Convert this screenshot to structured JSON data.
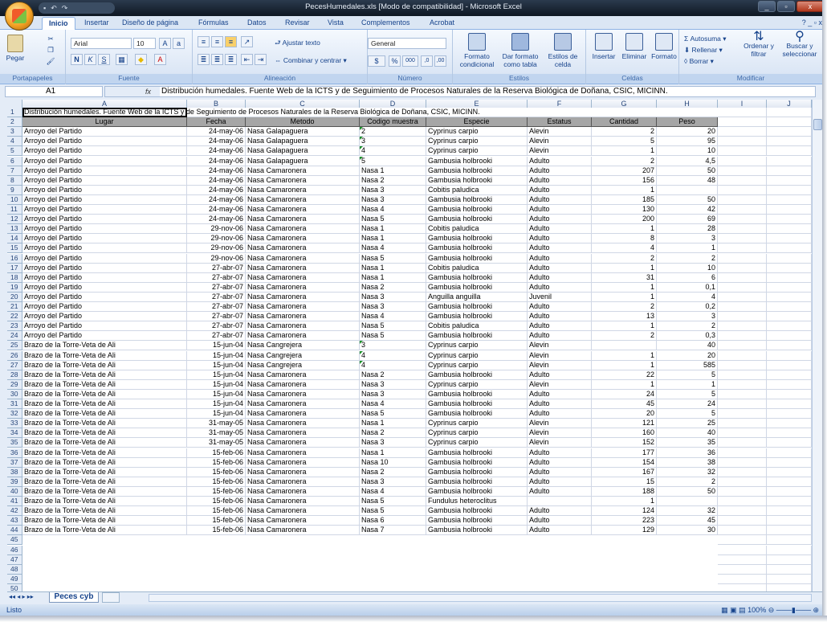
{
  "window": {
    "title": "PecesHumedales.xls  [Modo de compatibilidad] - Microsoft Excel",
    "controls": [
      "_",
      "▫",
      "x"
    ]
  },
  "tabs": [
    "Inicio",
    "Insertar",
    "Diseño de página",
    "Fórmulas",
    "Datos",
    "Revisar",
    "Vista",
    "Complementos",
    "Acrobat"
  ],
  "ribbon": {
    "paste": "Pegar",
    "clipboard_label": "Portapapeles",
    "font_name": "Arial",
    "font_size": "10",
    "font_label": "Fuente",
    "wrap_text": "Ajustar texto",
    "merge_center": "Combinar y centrar",
    "align_label": "Alineación",
    "number_format": "General",
    "number_label": "Número",
    "cond_format": "Formato condicional",
    "format_table": "Dar formato como tabla",
    "cell_styles": "Estilos de celda",
    "styles_label": "Estilos",
    "insert": "Insertar",
    "delete": "Eliminar",
    "format": "Formato",
    "cells_label": "Celdas",
    "autosum": "Autosuma",
    "fill": "Rellenar",
    "clear": "Borrar",
    "sort_filter": "Ordenar y filtrar",
    "find_select": "Buscar y seleccionar",
    "modify_label": "Modificar"
  },
  "formula_bar": {
    "name_box": "A1",
    "fx": "fx",
    "content": "Distribución humedales. Fuente Web de la ICTS y de Seguimiento de Procesos Naturales de la Reserva Biológica de Doñana, CSIC, MICINN."
  },
  "columns": [
    "A",
    "B",
    "C",
    "D",
    "E",
    "F",
    "G",
    "H",
    "I",
    "J"
  ],
  "title_cell": "Distribución humedales. Fuente Web de la ICTS y de Seguimiento de Procesos Naturales de la Reserva Biológica de Doñana, CSIC, MICINN.",
  "headers": [
    "Lugar",
    "Fecha",
    "Metodo",
    "Codigo muestra",
    "Especie",
    "Estatus",
    "Cantidad",
    "Peso"
  ],
  "rows": [
    [
      "Arroyo del Partido",
      "24-may-06",
      "Nasa Galapaguera",
      "2",
      "Cyprinus carpio",
      "Alevin",
      "2",
      "20"
    ],
    [
      "Arroyo del Partido",
      "24-may-06",
      "Nasa Galapaguera",
      "3",
      "Cyprinus carpio",
      "Alevin",
      "5",
      "95"
    ],
    [
      "Arroyo del Partido",
      "24-may-06",
      "Nasa Galapaguera",
      "4",
      "Cyprinus carpio",
      "Alevin",
      "1",
      "10"
    ],
    [
      "Arroyo del Partido",
      "24-may-06",
      "Nasa Galapaguera",
      "5",
      "Gambusia holbrooki",
      "Adulto",
      "2",
      "4,5"
    ],
    [
      "Arroyo del Partido",
      "24-may-06",
      "Nasa Camaronera",
      "Nasa 1",
      "Gambusia holbrooki",
      "Adulto",
      "207",
      "50"
    ],
    [
      "Arroyo del Partido",
      "24-may-06",
      "Nasa Camaronera",
      "Nasa 2",
      "Gambusia holbrooki",
      "Adulto",
      "156",
      "48"
    ],
    [
      "Arroyo del Partido",
      "24-may-06",
      "Nasa Camaronera",
      "Nasa 3",
      "Cobitis paludica",
      "Adulto",
      "1",
      ""
    ],
    [
      "Arroyo del Partido",
      "24-may-06",
      "Nasa Camaronera",
      "Nasa 3",
      "Gambusia holbrooki",
      "Adulto",
      "185",
      "50"
    ],
    [
      "Arroyo del Partido",
      "24-may-06",
      "Nasa Camaronera",
      "Nasa 4",
      "Gambusia holbrooki",
      "Adulto",
      "130",
      "42"
    ],
    [
      "Arroyo del Partido",
      "24-may-06",
      "Nasa Camaronera",
      "Nasa 5",
      "Gambusia holbrooki",
      "Adulto",
      "200",
      "69"
    ],
    [
      "Arroyo del Partido",
      "29-nov-06",
      "Nasa Camaronera",
      "Nasa 1",
      "Cobitis paludica",
      "Adulto",
      "1",
      "28"
    ],
    [
      "Arroyo del Partido",
      "29-nov-06",
      "Nasa Camaronera",
      "Nasa 1",
      "Gambusia holbrooki",
      "Adulto",
      "8",
      "3"
    ],
    [
      "Arroyo del Partido",
      "29-nov-06",
      "Nasa Camaronera",
      "Nasa 4",
      "Gambusia holbrooki",
      "Adulto",
      "4",
      "1"
    ],
    [
      "Arroyo del Partido",
      "29-nov-06",
      "Nasa Camaronera",
      "Nasa 5",
      "Gambusia holbrooki",
      "Adulto",
      "2",
      "2"
    ],
    [
      "Arroyo del Partido",
      "27-abr-07",
      "Nasa Camaronera",
      "Nasa 1",
      "Cobitis paludica",
      "Adulto",
      "1",
      "10"
    ],
    [
      "Arroyo del Partido",
      "27-abr-07",
      "Nasa Camaronera",
      "Nasa 1",
      "Gambusia holbrooki",
      "Adulto",
      "31",
      "6"
    ],
    [
      "Arroyo del Partido",
      "27-abr-07",
      "Nasa Camaronera",
      "Nasa 2",
      "Gambusia holbrooki",
      "Adulto",
      "1",
      "0,1"
    ],
    [
      "Arroyo del Partido",
      "27-abr-07",
      "Nasa Camaronera",
      "Nasa 3",
      "Anguilla anguilla",
      "Juvenil",
      "1",
      "4"
    ],
    [
      "Arroyo del Partido",
      "27-abr-07",
      "Nasa Camaronera",
      "Nasa 3",
      "Gambusia holbrooki",
      "Adulto",
      "2",
      "0,2"
    ],
    [
      "Arroyo del Partido",
      "27-abr-07",
      "Nasa Camaronera",
      "Nasa 4",
      "Gambusia holbrooki",
      "Adulto",
      "13",
      "3"
    ],
    [
      "Arroyo del Partido",
      "27-abr-07",
      "Nasa Camaronera",
      "Nasa 5",
      "Cobitis paludica",
      "Adulto",
      "1",
      "2"
    ],
    [
      "Arroyo del Partido",
      "27-abr-07",
      "Nasa Camaronera",
      "Nasa 5",
      "Gambusia holbrooki",
      "Adulto",
      "2",
      "0,3"
    ],
    [
      "Brazo de la Torre-Veta de Ali",
      "15-jun-04",
      "Nasa Cangrejera",
      "3",
      "Cyprinus carpio",
      "Alevin",
      "",
      "40"
    ],
    [
      "Brazo de la Torre-Veta de Ali",
      "15-jun-04",
      "Nasa Cangrejera",
      "4",
      "Cyprinus carpio",
      "Alevin",
      "1",
      "20"
    ],
    [
      "Brazo de la Torre-Veta de Ali",
      "15-jun-04",
      "Nasa Cangrejera",
      "4",
      "Cyprinus carpio",
      "Alevin",
      "1",
      "585"
    ],
    [
      "Brazo de la Torre-Veta de Ali",
      "15-jun-04",
      "Nasa Camaronera",
      "Nasa 2",
      "Gambusia holbrooki",
      "Adulto",
      "22",
      "5"
    ],
    [
      "Brazo de la Torre-Veta de Ali",
      "15-jun-04",
      "Nasa Camaronera",
      "Nasa 3",
      "Cyprinus carpio",
      "Alevin",
      "1",
      "1"
    ],
    [
      "Brazo de la Torre-Veta de Ali",
      "15-jun-04",
      "Nasa Camaronera",
      "Nasa 3",
      "Gambusia holbrooki",
      "Adulto",
      "24",
      "5"
    ],
    [
      "Brazo de la Torre-Veta de Ali",
      "15-jun-04",
      "Nasa Camaronera",
      "Nasa 4",
      "Gambusia holbrooki",
      "Adulto",
      "45",
      "24"
    ],
    [
      "Brazo de la Torre-Veta de Ali",
      "15-jun-04",
      "Nasa Camaronera",
      "Nasa 5",
      "Gambusia holbrooki",
      "Adulto",
      "20",
      "5"
    ],
    [
      "Brazo de la Torre-Veta de Ali",
      "31-may-05",
      "Nasa Camaronera",
      "Nasa 1",
      "Cyprinus carpio",
      "Alevin",
      "121",
      "25"
    ],
    [
      "Brazo de la Torre-Veta de Ali",
      "31-may-05",
      "Nasa Camaronera",
      "Nasa 2",
      "Cyprinus carpio",
      "Alevin",
      "160",
      "40"
    ],
    [
      "Brazo de la Torre-Veta de Ali",
      "31-may-05",
      "Nasa Camaronera",
      "Nasa 3",
      "Cyprinus carpio",
      "Alevin",
      "152",
      "35"
    ],
    [
      "Brazo de la Torre-Veta de Ali",
      "15-feb-06",
      "Nasa Camaronera",
      "Nasa 1",
      "Gambusia holbrooki",
      "Adulto",
      "177",
      "36"
    ],
    [
      "Brazo de la Torre-Veta de Ali",
      "15-feb-06",
      "Nasa Camaronera",
      "Nasa 10",
      "Gambusia holbrooki",
      "Adulto",
      "154",
      "38"
    ],
    [
      "Brazo de la Torre-Veta de Ali",
      "15-feb-06",
      "Nasa Camaronera",
      "Nasa 2",
      "Gambusia holbrooki",
      "Adulto",
      "167",
      "32"
    ],
    [
      "Brazo de la Torre-Veta de Ali",
      "15-feb-06",
      "Nasa Camaronera",
      "Nasa 3",
      "Gambusia holbrooki",
      "Adulto",
      "15",
      "2"
    ],
    [
      "Brazo de la Torre-Veta de Ali",
      "15-feb-06",
      "Nasa Camaronera",
      "Nasa 4",
      "Gambusia holbrooki",
      "Adulto",
      "188",
      "50"
    ],
    [
      "Brazo de la Torre-Veta de Ali",
      "15-feb-06",
      "Nasa Camaronera",
      "Nasa 5",
      "Fundulus heteroclitus",
      "",
      "1",
      ""
    ],
    [
      "Brazo de la Torre-Veta de Ali",
      "15-feb-06",
      "Nasa Camaronera",
      "Nasa 5",
      "Gambusia holbrooki",
      "Adulto",
      "124",
      "32"
    ],
    [
      "Brazo de la Torre-Veta de Ali",
      "15-feb-06",
      "Nasa Camaronera",
      "Nasa 6",
      "Gambusia holbrooki",
      "Adulto",
      "223",
      "45"
    ],
    [
      "Brazo de la Torre-Veta de Ali",
      "15-feb-06",
      "Nasa Camaronera",
      "Nasa 7",
      "Gambusia holbrooki",
      "Adulto",
      "129",
      "30"
    ]
  ],
  "sheet_tab": "Peces cyb",
  "status": "Listo",
  "zoom": "100%"
}
